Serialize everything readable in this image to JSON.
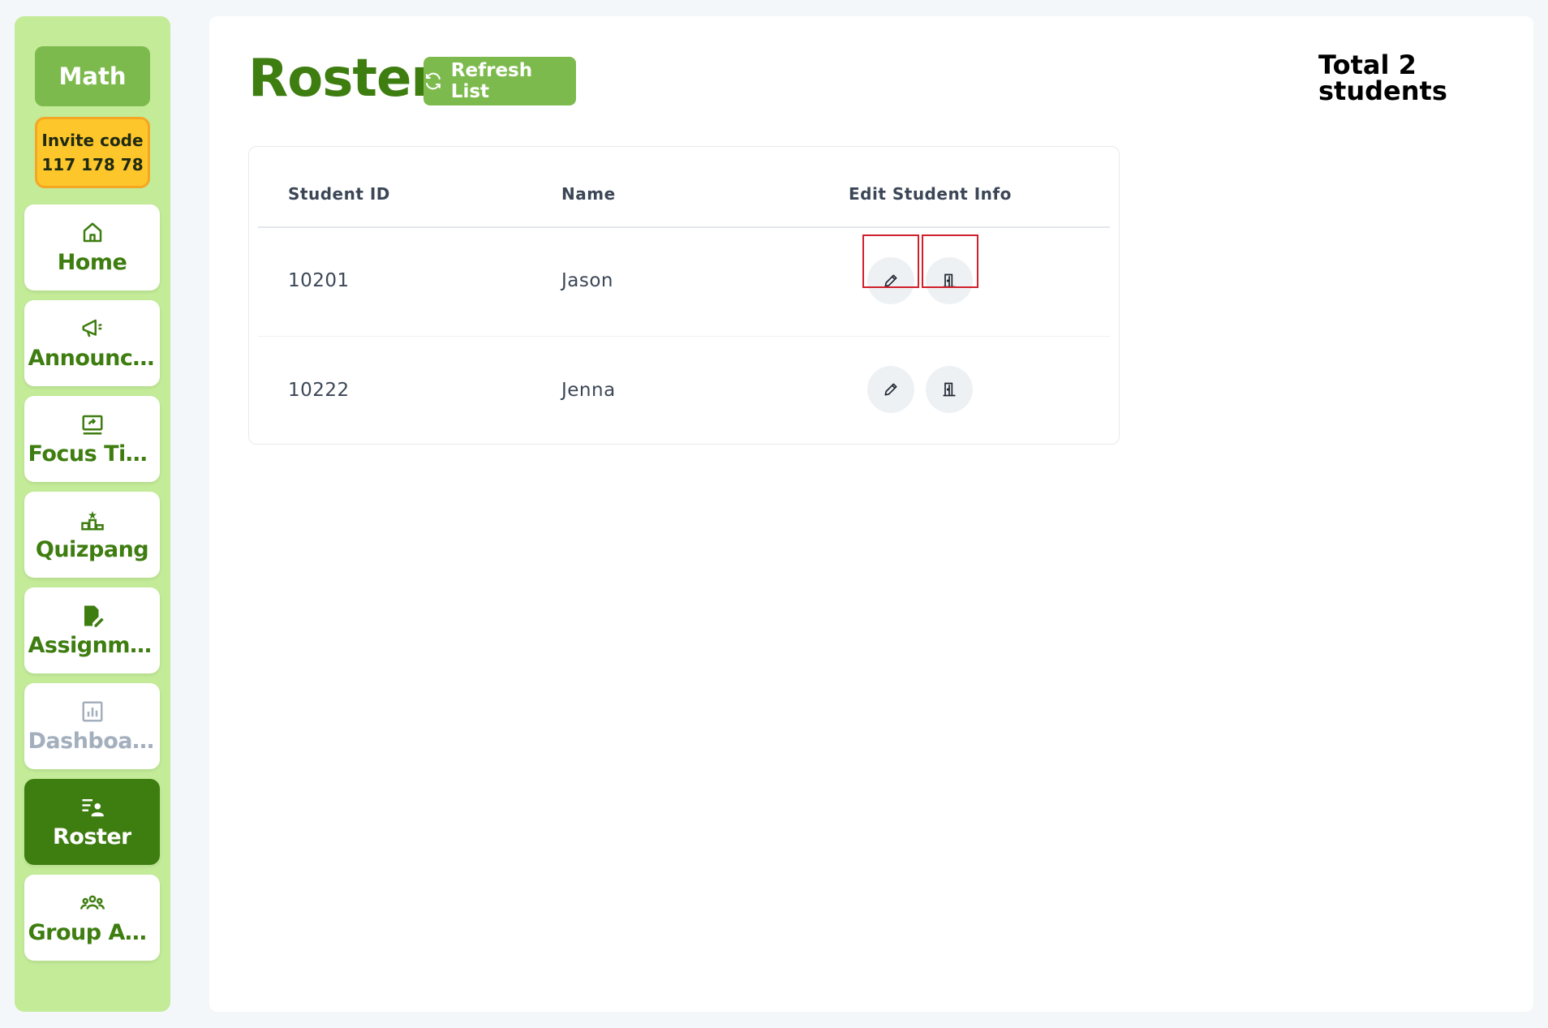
{
  "sidebar": {
    "class_name": "Math",
    "invite_label": "Invite code",
    "invite_code": "117 178 78",
    "items": [
      {
        "label": "Home",
        "icon": "home-icon"
      },
      {
        "label": "Announcements",
        "icon": "megaphone-icon"
      },
      {
        "label": "Focus Time",
        "icon": "screen-share-icon"
      },
      {
        "label": "Quizpang",
        "icon": "podium-icon"
      },
      {
        "label": "Assignments",
        "icon": "edit-document-icon"
      },
      {
        "label": "Dashboard",
        "icon": "bar-chart-icon",
        "state": "disabled"
      },
      {
        "label": "Roster",
        "icon": "roster-icon",
        "state": "active"
      },
      {
        "label": "Group Activities",
        "icon": "group-icon"
      }
    ]
  },
  "header": {
    "title": "Roster",
    "refresh_label": "Refresh List",
    "total_label": "Total 2 students"
  },
  "table": {
    "columns": [
      "Student ID",
      "Name",
      "Edit Student Info"
    ],
    "rows": [
      {
        "id": "10201",
        "name": "Jason"
      },
      {
        "id": "10222",
        "name": "Jenna"
      }
    ]
  },
  "colors": {
    "primary_green": "#3e7d10",
    "button_green": "#7dba4d",
    "sidebar_bg": "#c3eb98",
    "invite_yellow": "#fdc62a",
    "highlight_red": "#d0202a"
  }
}
